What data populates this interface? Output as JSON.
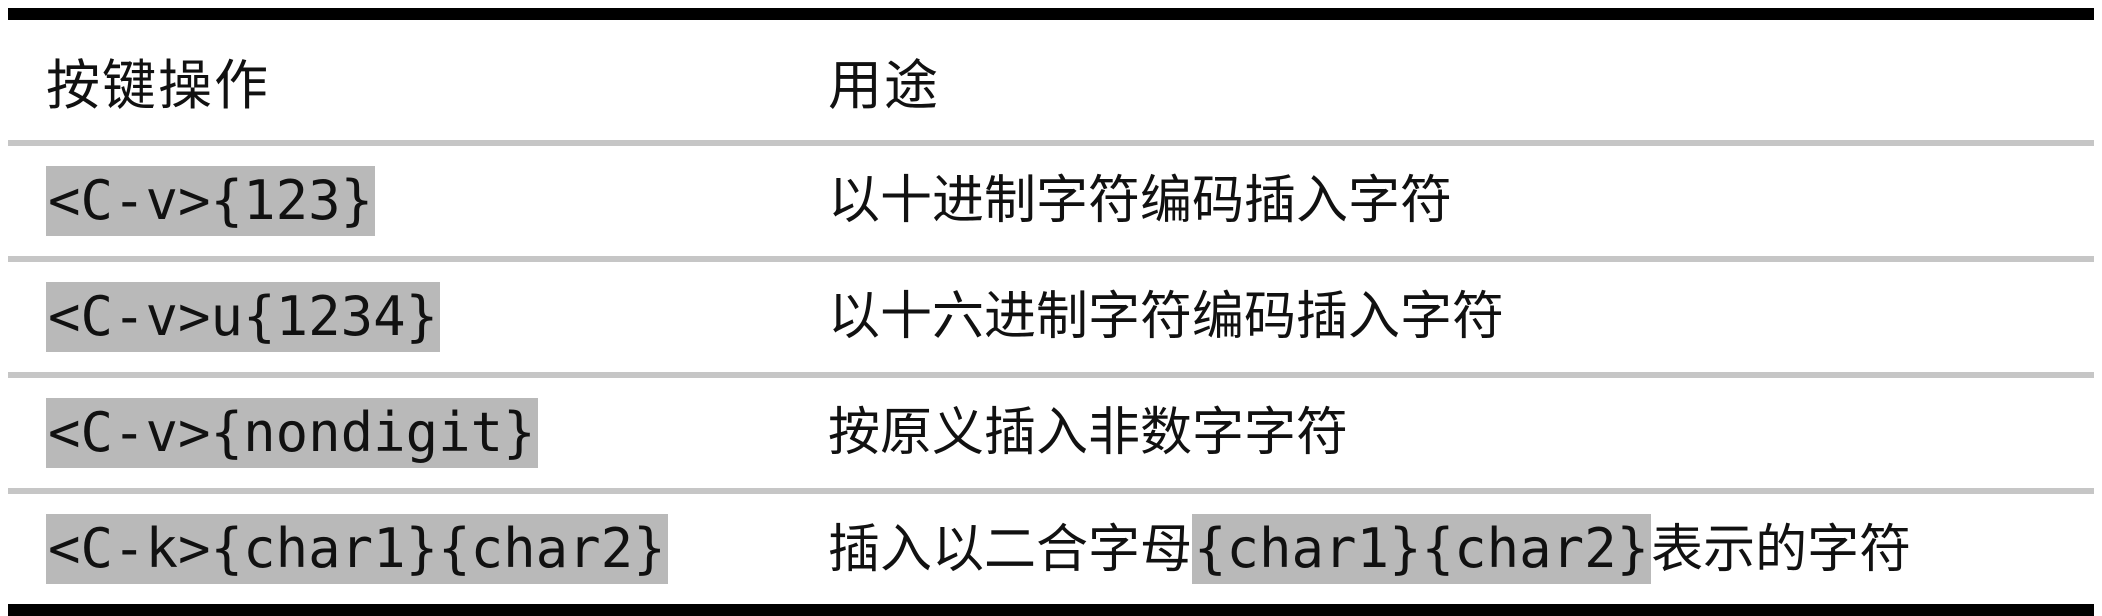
{
  "table": {
    "headers": {
      "key": "按键操作",
      "use": "用途"
    },
    "rows": [
      {
        "key": "<C-v>{123}",
        "use": "以十进制字符编码插入字符"
      },
      {
        "key": "<C-v>u{1234}",
        "use": "以十六进制字符编码插入字符"
      },
      {
        "key": "<C-v>{nondigit}",
        "use": "按原义插入非数字字符"
      },
      {
        "key": "<C-k>{char1}{char2}",
        "use_before": "插入以二合字母",
        "use_code": "{char1}{char2}",
        "use_after": "表示的字符"
      }
    ]
  }
}
